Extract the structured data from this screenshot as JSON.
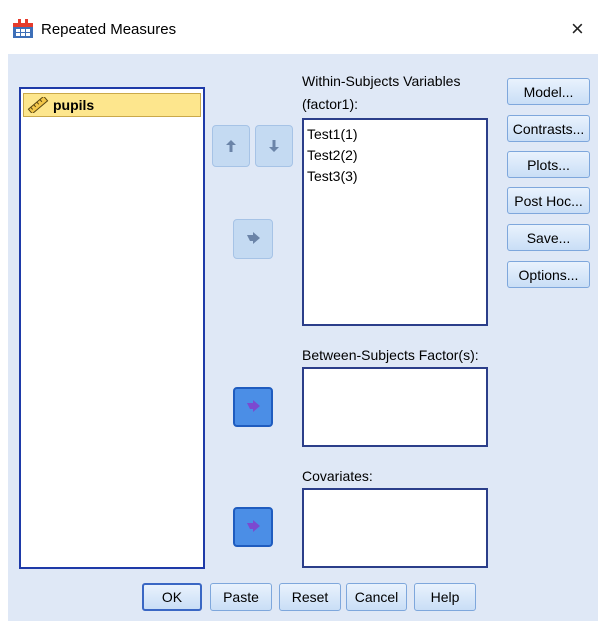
{
  "window": {
    "title": "Repeated Measures",
    "close_symbol": "×"
  },
  "variables": [
    {
      "name": "pupils",
      "icon": "ruler-scale-icon"
    }
  ],
  "within": {
    "label": "Within-Subjects Variables",
    "sublabel": "(factor1):",
    "items": [
      "Test1(1)",
      "Test2(2)",
      "Test3(3)"
    ]
  },
  "between": {
    "label": "Between-Subjects Factor(s):",
    "items": []
  },
  "covariates": {
    "label": "Covariates:",
    "items": []
  },
  "side_buttons": [
    "Model...",
    "Contrasts...",
    "Plots...",
    "Post Hoc...",
    "Save...",
    "Options..."
  ],
  "bottom_buttons": [
    "OK",
    "Paste",
    "Reset",
    "Cancel",
    "Help"
  ],
  "colors": {
    "panel": "#dfe8f6",
    "selection": "#fde68d",
    "list_border": "#1e3aa8",
    "arrow_enabled": "#4b8ee6",
    "arrow_disabled": "#c4daf2"
  }
}
